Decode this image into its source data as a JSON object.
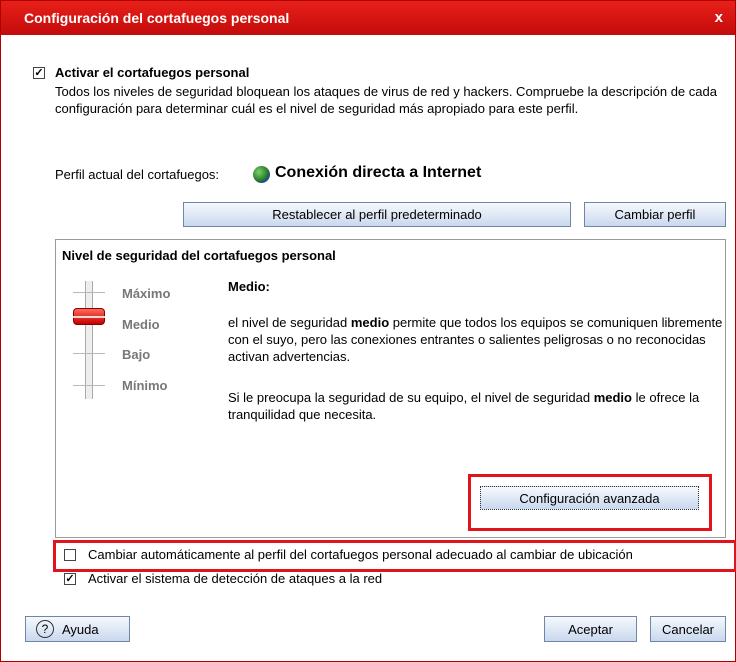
{
  "window": {
    "title": "Configuración del cortafuegos personal",
    "close": "x"
  },
  "firewall": {
    "enable_label": "Activar el cortafuegos personal",
    "enable_checked": true,
    "description": "Todos los niveles de seguridad bloquean los ataques de virus de red y hackers. Compruebe la descripción de cada configuración para determinar cuál es el nivel de seguridad más apropiado para este perfil."
  },
  "profile": {
    "current_label": "Perfil actual del cortafuegos:",
    "current_value": "Conexión directa a Internet",
    "icon": "globe-icon",
    "reset_button": "Restablecer al perfil predeterminado",
    "change_button": "Cambiar perfil"
  },
  "security": {
    "panel_title": "Nivel de seguridad del cortafuegos personal",
    "levels": [
      "Máximo",
      "Medio",
      "Bajo",
      "Mínimo"
    ],
    "selected_level": "Medio",
    "heading": "Medio:",
    "text1_pre": "el nivel de seguridad ",
    "text1_bold": "medio",
    "text1_post": " permite que todos los equipos se comuniquen libremente con el suyo, pero las conexiones entrantes o salientes peligrosas o no reconocidas activan advertencias.",
    "text2_pre": "Si le preocupa la seguridad de su equipo, el nivel de seguridad ",
    "text2_bold": "medio",
    "text2_post": " le ofrece la tranquilidad que necesita.",
    "advanced_button": "Configuración avanzada"
  },
  "options": {
    "auto_change_label": "Cambiar automáticamente al perfil del cortafuegos personal adecuado al cambiar de ubicación",
    "auto_change_checked": false,
    "ids_label": "Activar el sistema de detección de ataques a la red",
    "ids_checked": true
  },
  "footer": {
    "help_button": "Ayuda",
    "help_icon": "?",
    "ok_button": "Aceptar",
    "cancel_button": "Cancelar"
  },
  "colors": {
    "title_bar": "#d01410",
    "highlight_box": "#e0141a"
  }
}
